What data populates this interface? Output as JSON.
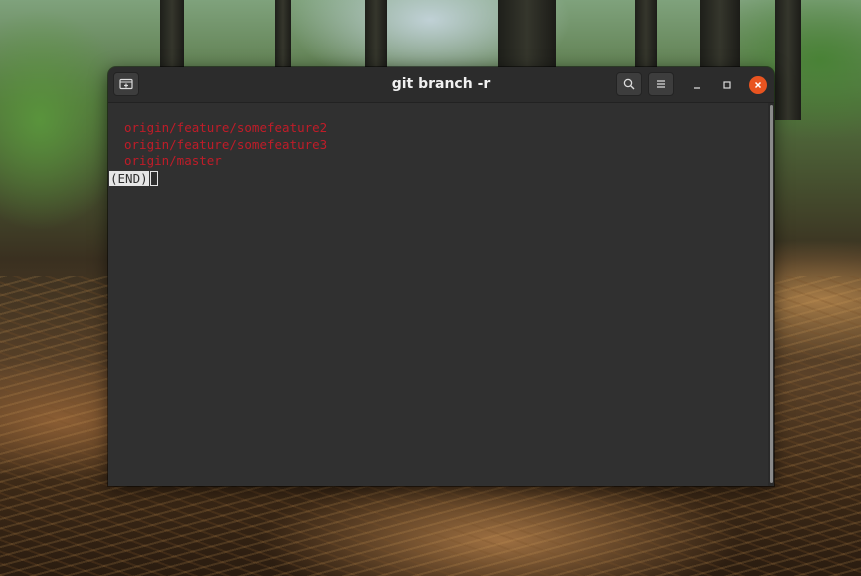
{
  "window": {
    "title": "git branch -r"
  },
  "titlebar": {
    "new_tab_icon": "new-tab-icon",
    "search_icon": "search-icon",
    "menu_icon": "hamburger-menu-icon",
    "minimize_glyph": "–",
    "maximize_glyph": "□",
    "close_glyph": "×"
  },
  "terminal": {
    "branches": [
      "origin/feature/somefeature2",
      "origin/feature/somefeature3",
      "origin/master"
    ],
    "pager_end": "(END)"
  },
  "colors": {
    "branch_text": "#c01c28",
    "terminal_bg": "#303030",
    "close_button": "#e95420"
  }
}
